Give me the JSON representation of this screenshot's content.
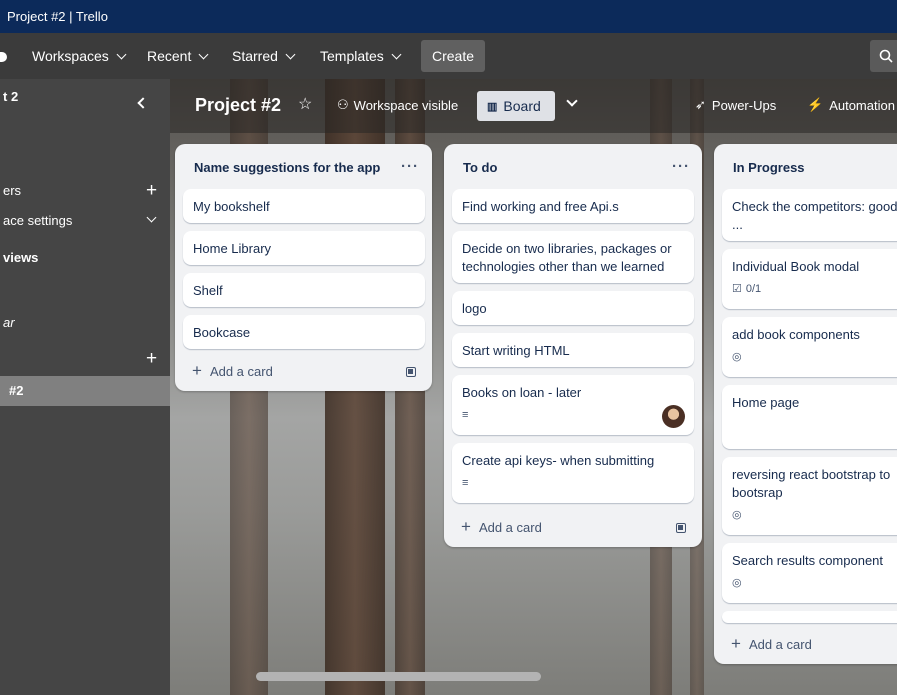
{
  "titlebar": {
    "text": "Project #2 | Trello"
  },
  "topnav": {
    "workspaces": "Workspaces",
    "recent": "Recent",
    "starred": "Starred",
    "templates": "Templates",
    "create": "Create"
  },
  "sidebar": {
    "title": "t 2",
    "items": [
      {
        "label": "ers"
      },
      {
        "label": "ace settings"
      },
      {
        "label": "views"
      },
      {
        "label": "ar"
      }
    ],
    "active_board": "#2"
  },
  "board_header": {
    "title": "Project #2",
    "visibility": "Workspace visible",
    "view": "Board",
    "power_ups": "Power-Ups",
    "automation": "Automation"
  },
  "lists": [
    {
      "title": "Name suggestions for the app",
      "cards": [
        {
          "text": "My bookshelf"
        },
        {
          "text": "Home Library"
        },
        {
          "text": "Shelf"
        },
        {
          "text": "Bookcase"
        }
      ],
      "add_card": "Add a card"
    },
    {
      "title": "To do",
      "cards": [
        {
          "text": "Find working and free Api.s"
        },
        {
          "text": "Decide on two libraries, packages or technologies other than we learned"
        },
        {
          "text": "logo"
        },
        {
          "text": "Start writing HTML"
        },
        {
          "text": "Books on loan - later"
        },
        {
          "text": "Create api keys- when submitting"
        }
      ],
      "add_card": "Add a card"
    },
    {
      "title": "In Progress",
      "cards": [
        {
          "text": "Check the competitors: good"
        },
        {
          "text": "Individual Book modal",
          "checklist": "0/1"
        },
        {
          "text": "add book components"
        },
        {
          "text": "Home page"
        },
        {
          "text": "reversing react bootstrap to bootsrap"
        },
        {
          "text": "Search results component"
        }
      ],
      "add_card": "Add a card"
    }
  ],
  "icons": {
    "description": "description-icon",
    "watch": "eye-icon",
    "checklist": "checklist-icon"
  }
}
